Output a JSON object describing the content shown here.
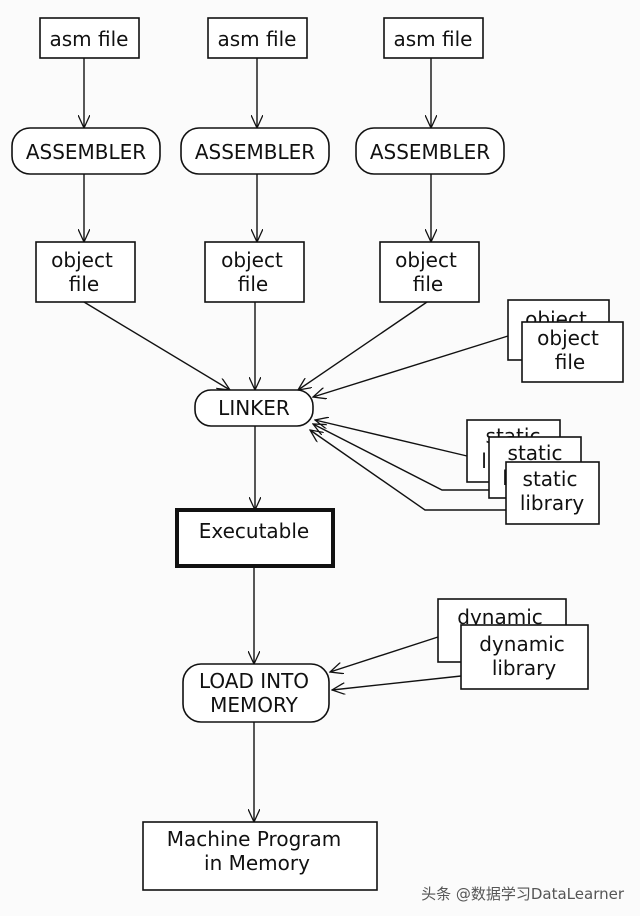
{
  "sources": [
    {
      "asm": "asm file",
      "assembler": "ASSEMBLER",
      "object": [
        "object",
        "file"
      ]
    },
    {
      "asm": "asm file",
      "assembler": "ASSEMBLER",
      "object": [
        "object",
        "file"
      ]
    },
    {
      "asm": "asm file",
      "assembler": "ASSEMBLER",
      "object": [
        "object",
        "file"
      ]
    }
  ],
  "linker": "LINKER",
  "extra_object": {
    "back": "object",
    "front": [
      "object",
      "file"
    ]
  },
  "static_libs": {
    "back1": "static",
    "back1_second": "l",
    "back2": "static",
    "back2_second": "l",
    "front": [
      "static",
      "library"
    ]
  },
  "executable": "Executable",
  "dynamic_libs": {
    "back": "dynamic",
    "front": [
      "dynamic",
      "library"
    ]
  },
  "loader": [
    "LOAD INTO",
    "MEMORY"
  ],
  "result": [
    "Machine Program",
    "in Memory"
  ],
  "watermark": "头条 @数据学习DataLearner"
}
